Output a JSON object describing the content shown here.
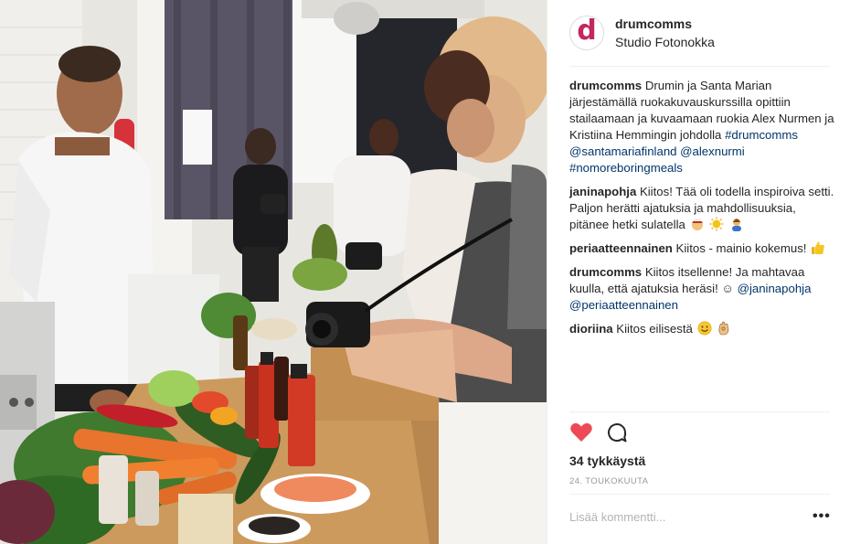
{
  "post": {
    "author": {
      "avatar_letter": "d",
      "avatar_color": "#c4265f",
      "username": "drumcomms",
      "location": "Studio Fotonokka"
    },
    "caption": {
      "username": "drumcomms",
      "text": "Drumin ja Santa Marian järjestämällä ruokakuvauskurssilla opittiin stailaamaan ja kuvaamaan ruokia Alex Nurmen ja Kristiina Hemmingin johdolla",
      "hashtag_drum": "#drumcomms",
      "mention_santa": "@santamariafinland",
      "mention_alex": "@alexnurmi",
      "hashtag_boring": "#nomoreboringmeals"
    },
    "comments": [
      {
        "username": "janinapohja",
        "text": "Kiitos! Tää oli todella inspiroiva setti. Paljon herätti ajatuksia ja mahdollisuuksia, pitänee hetki sulatella",
        "emojis": [
          "woman-cook-emoji",
          "sun-emoji",
          "woman-emoji"
        ]
      },
      {
        "username": "periaatteennainen",
        "text": "Kiitos - mainio kokemus!",
        "emojis": [
          "thumbs-up-emoji"
        ]
      },
      {
        "username": "drumcomms",
        "text": "Kiitos itsellenne! Ja mahtavaa kuulla, että ajatuksia heräsi!",
        "emoji": "☺",
        "mention_1": "@janinapohja",
        "mention_2": "@periaatteennainen"
      },
      {
        "username": "dioriina",
        "text": "Kiitos eilisestä",
        "emojis": [
          "smile-emoji",
          "ok-hand-emoji"
        ]
      }
    ],
    "likes": "34 tykkäystä",
    "date": "24. TOUKOKUUTA",
    "comment_placeholder": "Lisää kommentti...",
    "more_label": "•••",
    "colors": {
      "heart": "#ed4956",
      "link": "#003569",
      "muted": "#999999"
    }
  }
}
